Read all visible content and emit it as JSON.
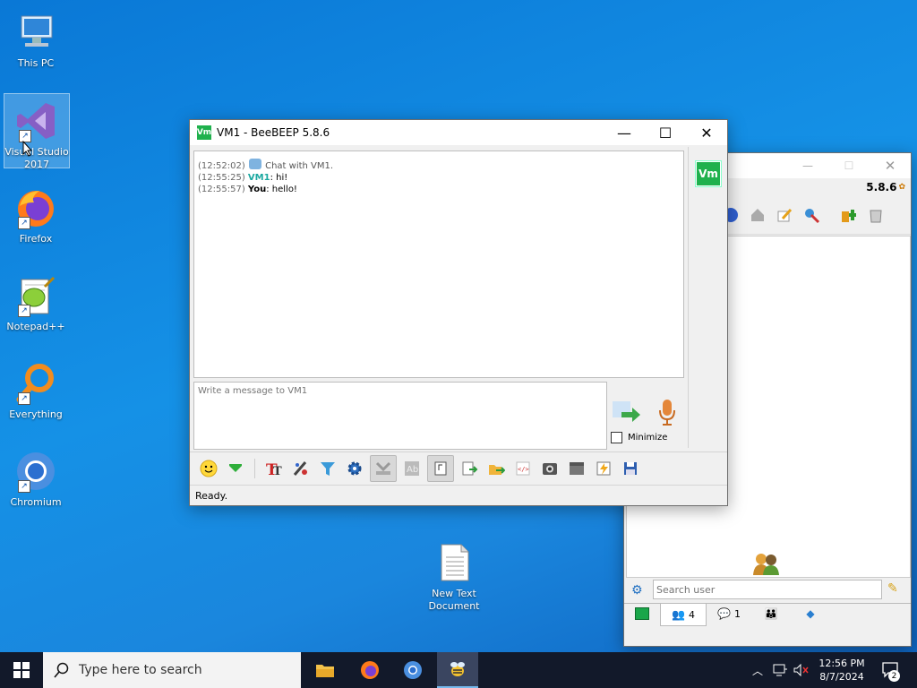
{
  "desktop": {
    "icons": [
      {
        "label_line1": "This PC",
        "label_line2": ""
      },
      {
        "label_line1": "Visual Studio",
        "label_line2": "2017"
      },
      {
        "label_line1": "Firefox",
        "label_line2": ""
      },
      {
        "label_line1": "Notepad++",
        "label_line2": ""
      },
      {
        "label_line1": "Everything",
        "label_line2": ""
      },
      {
        "label_line1": "Chromium",
        "label_line2": ""
      },
      {
        "label_line1": "New Text",
        "label_line2": "Document"
      }
    ]
  },
  "chat_window": {
    "badge": "Vm",
    "title": "VM1 - BeeBEEP 5.8.6",
    "messages": [
      {
        "time": "(12:52:02)",
        "sender": "",
        "text": "Chat with VM1."
      },
      {
        "time": "(12:55:25)",
        "sender": "VM1",
        "text": ": hi!"
      },
      {
        "time": "(12:55:57)",
        "sender": "You",
        "text": ": hello!"
      }
    ],
    "input_placeholder": "Write a message to VM1",
    "minimize_label": "Minimize",
    "status": "Ready.",
    "side_badge": "Vm"
  },
  "main_window": {
    "version": "5.8.6",
    "search_placeholder": "Search user",
    "tabs": [
      {
        "count": ""
      },
      {
        "count": "4"
      },
      {
        "count": "1"
      },
      {
        "count": ""
      },
      {
        "count": ""
      }
    ]
  },
  "taskbar": {
    "search_placeholder": "Type here to search",
    "time": "12:56 PM",
    "date": "8/7/2024",
    "notification_count": "2"
  },
  "colors": {
    "accent": "#0078d7",
    "badge_green": "#1fb14d",
    "vm1_name": "#1aa8a0"
  }
}
